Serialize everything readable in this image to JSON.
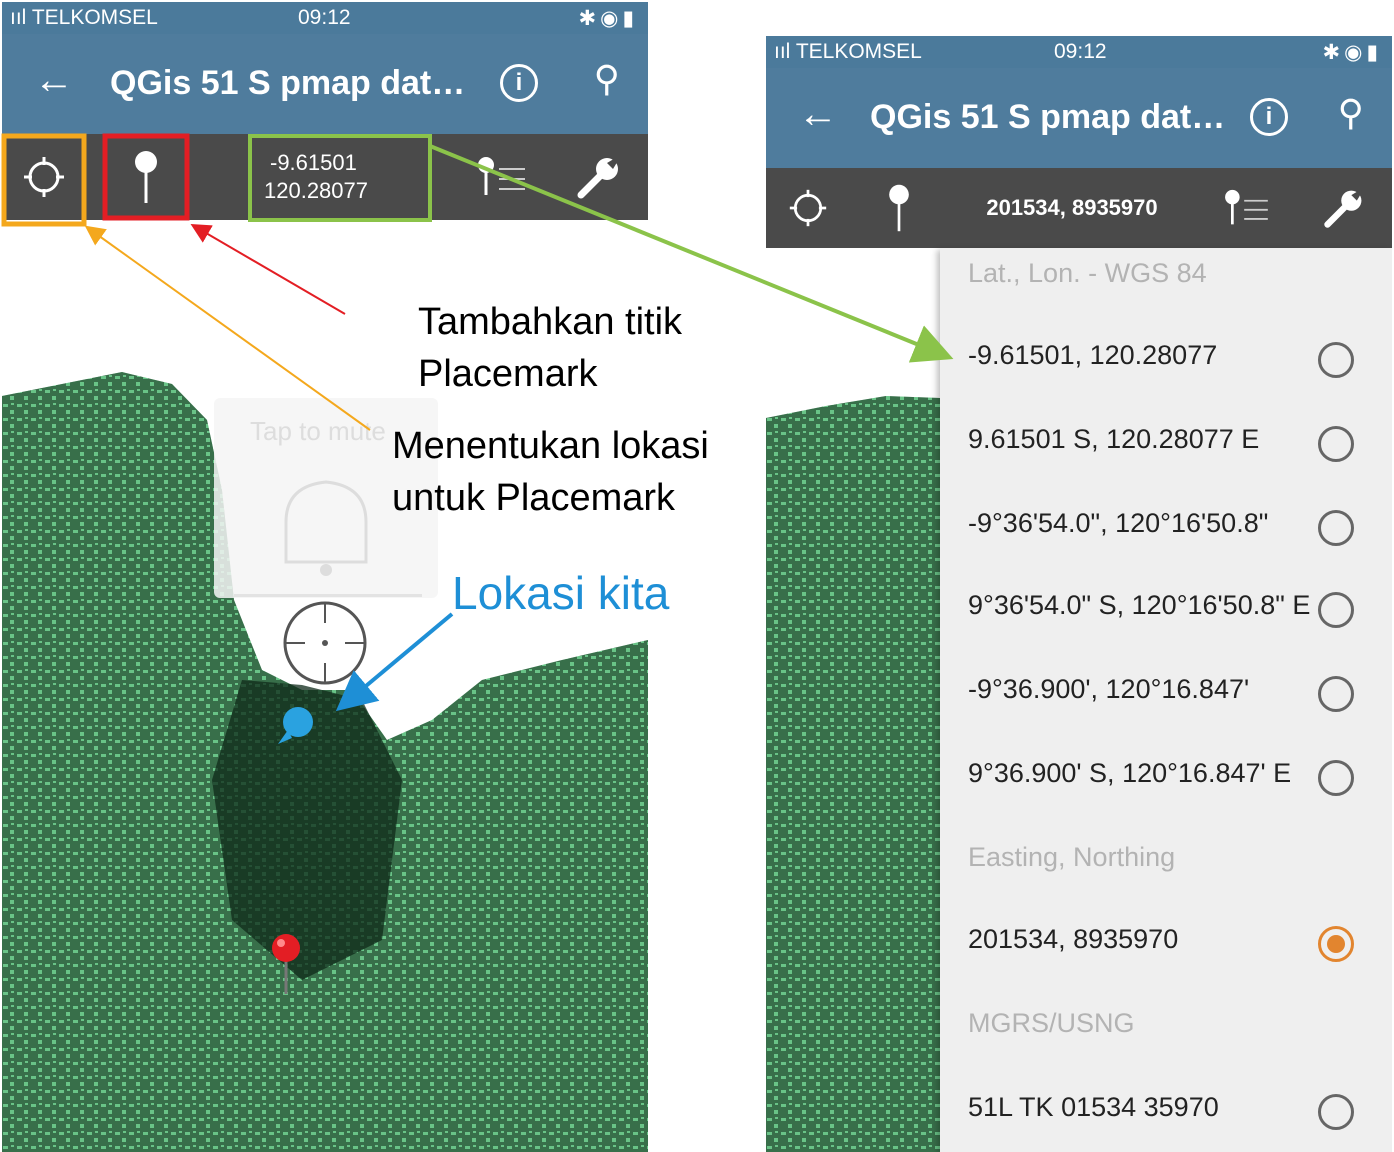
{
  "status_bar": {
    "carrier": "TELKOMSEL",
    "time": "09:12"
  },
  "app_bar": {
    "title": "QGis 51 S pmap dat…"
  },
  "left_toolbar": {
    "coord_line1": "-9.61501",
    "coord_line2": "120.28077"
  },
  "right_toolbar": {
    "coord_text": "201534, 8935970"
  },
  "annotations": {
    "add_placemark_line1": "Tambahkan titik",
    "add_placemark_line2": "Placemark",
    "locate_line1": "Menentukan lokasi",
    "locate_line2": "untuk Placemark",
    "our_location": "Lokasi kita",
    "toast_text": "Tap to mute"
  },
  "coord_format_menu": {
    "header_latlon": "Lat., Lon. - WGS 84",
    "header_easting": "Easting, Northing",
    "header_mgrs": "MGRS/USNG",
    "options": [
      {
        "label": "-9.61501, 120.28077",
        "selected": false
      },
      {
        "label": "9.61501 S, 120.28077 E",
        "selected": false
      },
      {
        "label": "-9°36'54.0\", 120°16'50.8\"",
        "selected": false
      },
      {
        "label": "9°36'54.0\" S, 120°16'50.8\" E",
        "selected": false
      },
      {
        "label": "-9°36.900', 120°16.847'",
        "selected": false
      },
      {
        "label": "9°36.900' S, 120°16.847' E",
        "selected": false
      },
      {
        "label": "201534, 8935970",
        "selected": true
      },
      {
        "label": "51L TK 01534 35970",
        "selected": false
      }
    ]
  },
  "colors": {
    "appbar": "#4f7c9d",
    "toolbar": "#4a4a4a",
    "map_green": "#69c387",
    "map_dark": "#0f2a19",
    "highlight_orange": "#f4a81d",
    "highlight_red": "#e31e24",
    "highlight_green": "#8bc34a",
    "annotation_blue": "#1e8fd6",
    "radio_selected": "#e2852f"
  }
}
